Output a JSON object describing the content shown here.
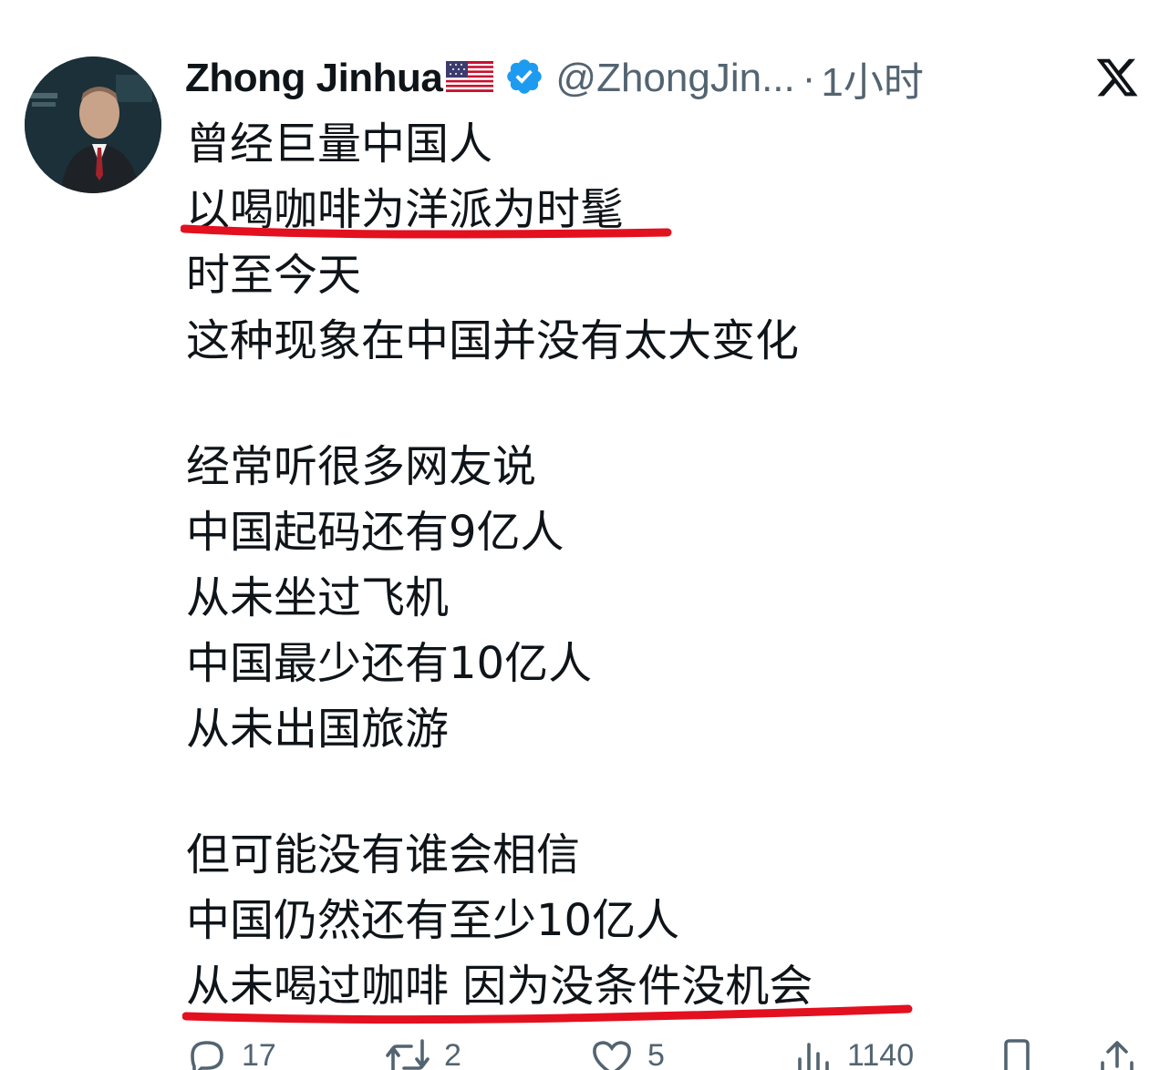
{
  "tweet": {
    "author_name": "Zhong Jinhua",
    "handle": "@ZhongJin...",
    "separator": "·",
    "time": "1小时",
    "flag_icon": "us-flag-icon",
    "verified_icon": "verified-badge-icon",
    "x_logo_icon": "x-logo-icon",
    "lines": [
      "曾经巨量中国人",
      "以喝咖啡为洋派为时髦",
      "时至今天",
      "这种现象在中国并没有太大变化",
      "经常听很多网友说",
      "中国起码还有9亿人",
      "从未坐过飞机",
      "中国最少还有10亿人",
      "从未出国旅游",
      "但可能没有谁会相信",
      "中国仍然还有至少10亿人",
      "从未喝过咖啡 因为没条件没机会"
    ],
    "underline_color": "#e3101f",
    "accent_color": "#1d9bf0"
  },
  "actions": {
    "reply": {
      "icon": "reply-icon",
      "count": "17"
    },
    "retweet": {
      "icon": "retweet-icon",
      "count": "2"
    },
    "like": {
      "icon": "heart-icon",
      "count": "5"
    },
    "views": {
      "icon": "views-chart-icon",
      "count": "1140"
    },
    "bookmark": {
      "icon": "bookmark-icon"
    },
    "share": {
      "icon": "share-icon"
    }
  }
}
